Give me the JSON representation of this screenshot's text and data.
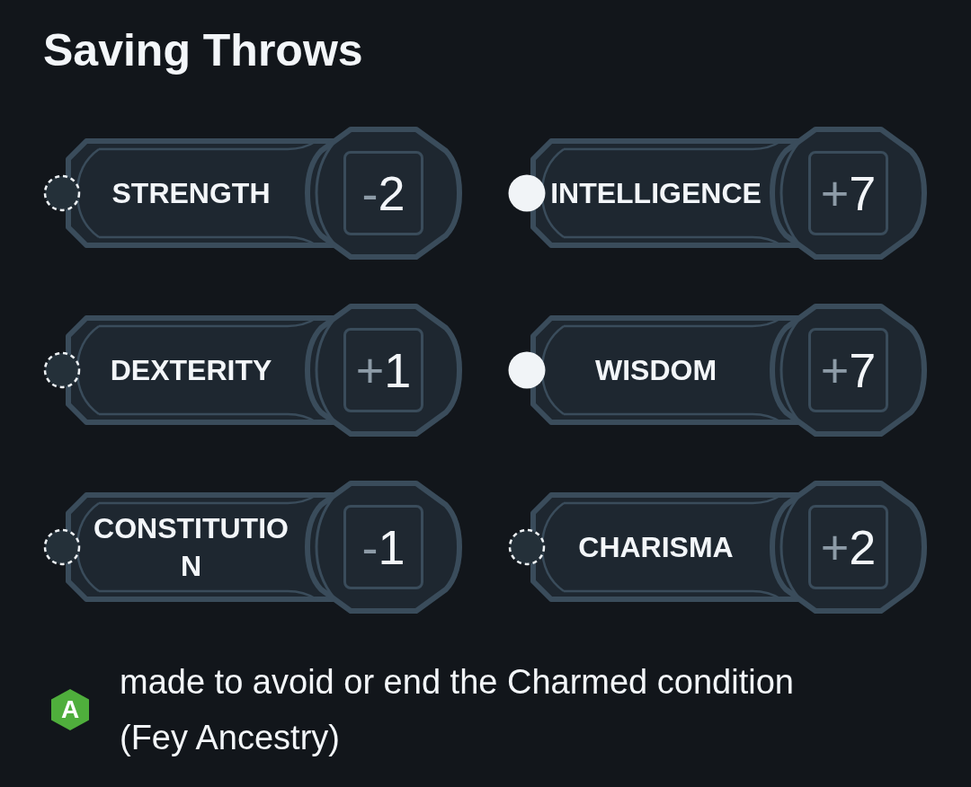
{
  "title": "Saving Throws",
  "saves": [
    {
      "ability": "STRENGTH",
      "proficient": false,
      "sign": "-",
      "number": "2"
    },
    {
      "ability": "INTELLIGENCE",
      "proficient": true,
      "sign": "+",
      "number": "7"
    },
    {
      "ability": "DEXTERITY",
      "proficient": false,
      "sign": "+",
      "number": "1"
    },
    {
      "ability": "WISDOM",
      "proficient": true,
      "sign": "+",
      "number": "7"
    },
    {
      "ability": "CONSTITUTION",
      "proficient": false,
      "sign": "-",
      "number": "1"
    },
    {
      "ability": "CHARISMA",
      "proficient": false,
      "sign": "+",
      "number": "2"
    }
  ],
  "note": {
    "badge": "A",
    "text": "made to avoid or end the Charmed condition (Fey Ancestry)"
  }
}
